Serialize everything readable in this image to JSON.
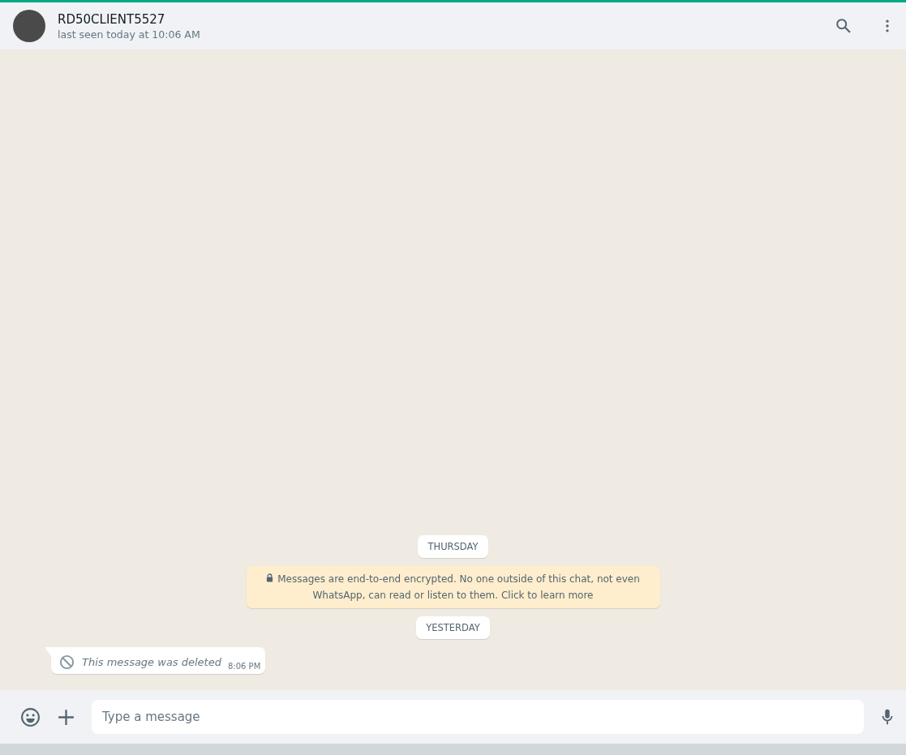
{
  "header": {
    "contact_name": "RD50CLIENT5527",
    "status": "last seen today at 10:06 AM"
  },
  "messages": [
    {
      "kind": "date",
      "text": "THURSDAY"
    },
    {
      "kind": "system",
      "text": "Messages are end-to-end encrypted. No one outside of this chat, not even WhatsApp, can read or listen to them. Click to learn more"
    },
    {
      "kind": "date",
      "text": "YESTERDAY"
    },
    {
      "kind": "deleted",
      "text": "This message was deleted",
      "time": "8:06 PM"
    }
  ],
  "composer": {
    "placeholder": "Type a message"
  }
}
